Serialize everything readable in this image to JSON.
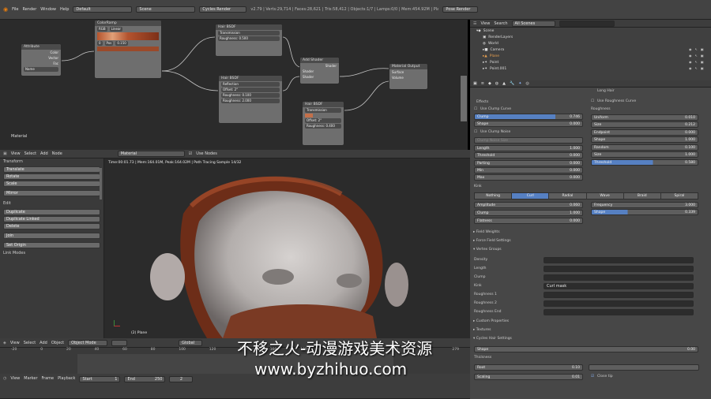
{
  "topbar": {
    "menus": [
      "File",
      "Render",
      "Window",
      "Help"
    ],
    "layout": "Default",
    "scene": "Scene",
    "engine": "Cycles Render",
    "stats": "v2.79 | Verts:29,714 | Faces:28,621 | Tris:58,412 | Objects:1/7 | Lamps:0/0 | Mem:454.92M | Plane",
    "workspace": "Pose Render"
  },
  "node_editor": {
    "label": "Material",
    "nodes": [
      {
        "title": "Attribute",
        "rows": [
          "Color",
          "Vector",
          "Fac",
          "Name"
        ]
      },
      {
        "title": "ColorRamp",
        "rows": [
          "RGB",
          "Linear",
          "0",
          "Pos",
          "0.150"
        ]
      },
      {
        "title": "Hair BSDF",
        "rows": [
          "Transmission",
          "Roughness: 0.500"
        ]
      },
      {
        "title": "Hair BSDF",
        "rows": [
          "Reflection",
          "Offset: 2°",
          "Roughness: 0.100",
          "Roughness: 2.000"
        ]
      },
      {
        "title": "Add Shader",
        "rows": [
          "Shader",
          "Shader",
          "Shader"
        ]
      },
      {
        "title": "Hair BSDF",
        "rows": [
          "Transmission",
          "Offset: 2°",
          "Roughness: 0.400"
        ]
      },
      {
        "title": "Material Output",
        "rows": [
          "Surface",
          "Volume"
        ]
      }
    ]
  },
  "toolshelf": {
    "transform_header": "Transform",
    "transform": [
      "Translate",
      "Rotate",
      "Scale"
    ],
    "mirror": "Mirror",
    "edit_header": "Edit",
    "edit": [
      "Duplicate",
      "Duplicate Linked",
      "Delete"
    ],
    "join": "Join",
    "set_origin": "Set Origin",
    "history": "Link Modes"
  },
  "viewport": {
    "header_menus": [
      "View",
      "Select",
      "Add",
      "Node"
    ],
    "material": "Material",
    "use_nodes": "Use Nodes",
    "status": "Time:00:01.73 | Mem:164.01M, Peak:164.02M | Path Tracing Sample 14/32",
    "object_label": "(2) Plane"
  },
  "timeline": {
    "menus": [
      "View",
      "Select",
      "Add",
      "Object"
    ],
    "mode": "Object Mode",
    "orientation": "Global",
    "ticks": [
      "-20",
      "0",
      "20",
      "40",
      "60",
      "80",
      "100",
      "120",
      "140",
      "160",
      "180",
      "200",
      "220",
      "240",
      "260",
      "279"
    ],
    "bottom_menus": [
      "View",
      "Marker",
      "Frame",
      "Playback"
    ],
    "start": "Start",
    "start_val": "1",
    "end": "End",
    "end_val": "250",
    "frame": "2"
  },
  "outliner": {
    "menus": [
      "View",
      "Search"
    ],
    "filter": "All Scenes",
    "items": [
      "Scene",
      "RenderLayers",
      "World",
      "Camera",
      "Plane",
      "Point",
      "Point.001"
    ]
  },
  "properties": {
    "top_checks": [
      "Long Hair",
      "Use Roughness Curve"
    ],
    "effects": "Effects",
    "use_clump": "Use Clump Curve",
    "clump": {
      "label": "Clump",
      "val": "0.746"
    },
    "shape": {
      "label": "Shape",
      "val": "0.000"
    },
    "use_clump_noise": "Use Clump Noise",
    "clump_noise": "Clump Noise Size",
    "left_fields": [
      {
        "label": "Length",
        "val": "1.000"
      },
      {
        "label": "Threshold",
        "val": "0.000"
      },
      {
        "label": "Parting",
        "val": "0.000"
      },
      {
        "label": "Min",
        "val": "0.000"
      },
      {
        "label": "Max",
        "val": "0.000"
      }
    ],
    "roughness": "Roughness",
    "right_fields": [
      {
        "label": "Uniform",
        "val": "0.010"
      },
      {
        "label": "Size",
        "val": "0.212"
      },
      {
        "label": "Endpoint",
        "val": "0.000"
      },
      {
        "label": "Shape",
        "val": "1.000"
      },
      {
        "label": "Random",
        "val": "0.100"
      },
      {
        "label": "Size",
        "val": "1.000"
      },
      {
        "label": "Threshold",
        "val": "0.580"
      }
    ],
    "kink": "Kink",
    "kink_tabs": [
      "Nothing",
      "Curl",
      "Radial",
      "Wave",
      "Braid",
      "Spiral"
    ],
    "kink_left": [
      {
        "label": "Amplitude",
        "val": "0.060"
      },
      {
        "label": "Clump",
        "val": "1.000"
      },
      {
        "label": "Flatness",
        "val": "0.000"
      }
    ],
    "kink_right": [
      {
        "label": "Frequency",
        "val": "3.000"
      },
      {
        "label": "Shape",
        "val": "0.339"
      }
    ],
    "sections": [
      "Field Weights",
      "Force Field Settings",
      "Vertex Groups"
    ],
    "vgroups": [
      "Density",
      "Length",
      "Clump",
      "Kink",
      "Roughness 1",
      "Roughness 2",
      "Roughness End"
    ],
    "kink_group": "Curl mask",
    "sections2": [
      "Custom Properties",
      "Textures",
      "Cycles Hair Settings"
    ],
    "hair_shape": {
      "label": "Shape",
      "val": "0.00"
    },
    "thickness": "Thickness",
    "root": {
      "label": "Root",
      "val": "0.10"
    },
    "scaling": {
      "label": "Scaling",
      "val": "0.01"
    },
    "close_tip": "Close tip"
  },
  "watermark": {
    "line1": "不移之火-动漫游戏美术资源",
    "line2": "www.byzhihuo.com"
  },
  "colors": {
    "accent": "#5680c2",
    "hair": "#8a3a1e",
    "node_bg": "#6e6e6e"
  }
}
